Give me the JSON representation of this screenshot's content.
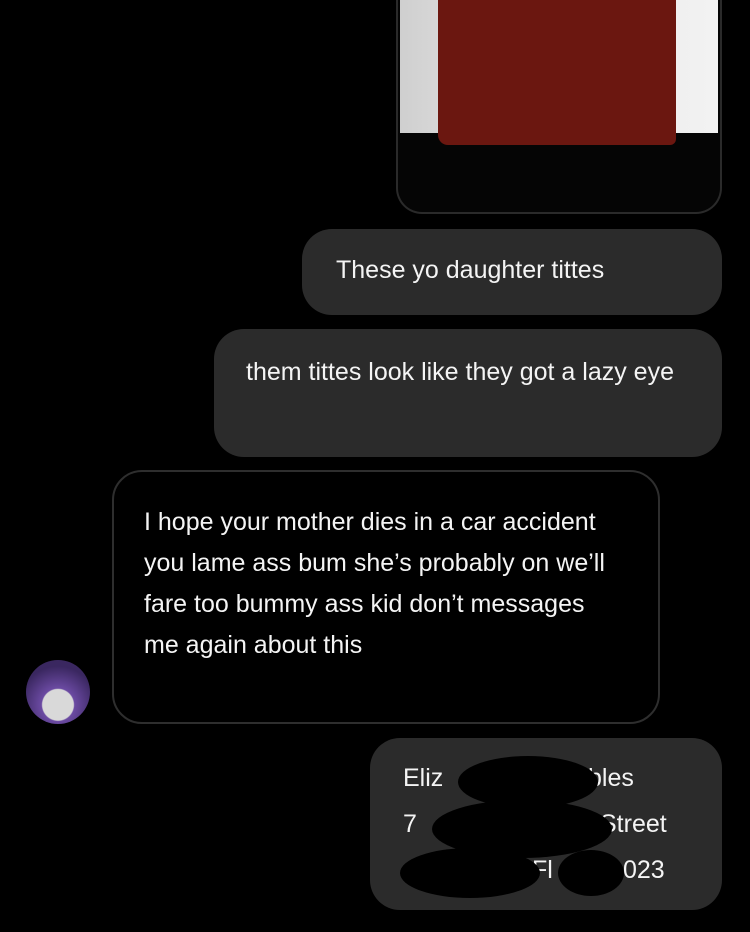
{
  "messages": [
    {
      "text": "These yo daughter tittes"
    },
    {
      "text": "them tittes look like they got a lazy eye"
    },
    {
      "text": "I hope your mother dies in a car accident you lame ass bum she’s probably  on we’ll fare too bummy ass kid don’t messages me again about this"
    }
  ],
  "address": {
    "line1_left": "Eliz",
    "line1_right": "bles",
    "line2_left": "7",
    "line2_right": "Street",
    "line3_mid": "Fl",
    "line3_right": "023"
  },
  "colors": {
    "background": "#000000",
    "sent_bubble": "#2b2b2b",
    "received_border": "#2e2e2e",
    "redaction_red": "#6b1710"
  }
}
